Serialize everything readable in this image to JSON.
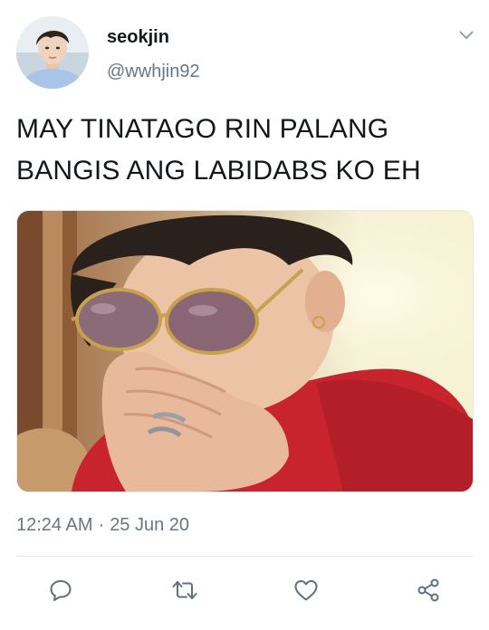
{
  "tweet": {
    "display_name": "seokjin",
    "handle": "@wwhjin92",
    "text": "MAY TINATAGO RIN PALANG BANGIS ANG LABIDABS KO EH",
    "time": "12:24 AM",
    "date": "25 Jun 20",
    "separator": "·"
  },
  "icons": {
    "menu": "chevron-down-icon",
    "reply": "reply-icon",
    "retweet": "retweet-icon",
    "like": "heart-icon",
    "share": "share-icon"
  },
  "colors": {
    "text": "#14171a",
    "secondary": "#657786",
    "divider": "#e1e8ed"
  }
}
